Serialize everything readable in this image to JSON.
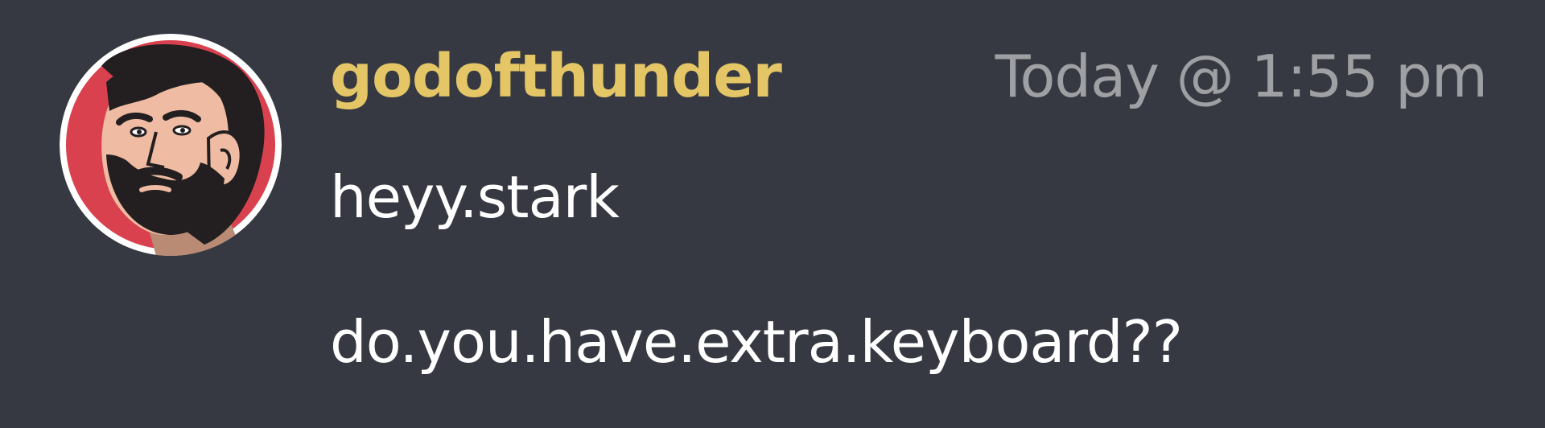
{
  "message": {
    "username": "godofthunder",
    "timestamp": "Today @ 1:55 pm",
    "lines": [
      "heyy.stark",
      "do.you.have.extra.keyboard??"
    ]
  },
  "avatar": {
    "icon": "bearded-man-avatar-icon"
  },
  "colors": {
    "background": "#363941",
    "username": "#e5c667",
    "timestamp": "#9fa0a3",
    "message_text": "#ffffff",
    "avatar_ring": "#ffffff",
    "avatar_background": "#d9414f"
  }
}
